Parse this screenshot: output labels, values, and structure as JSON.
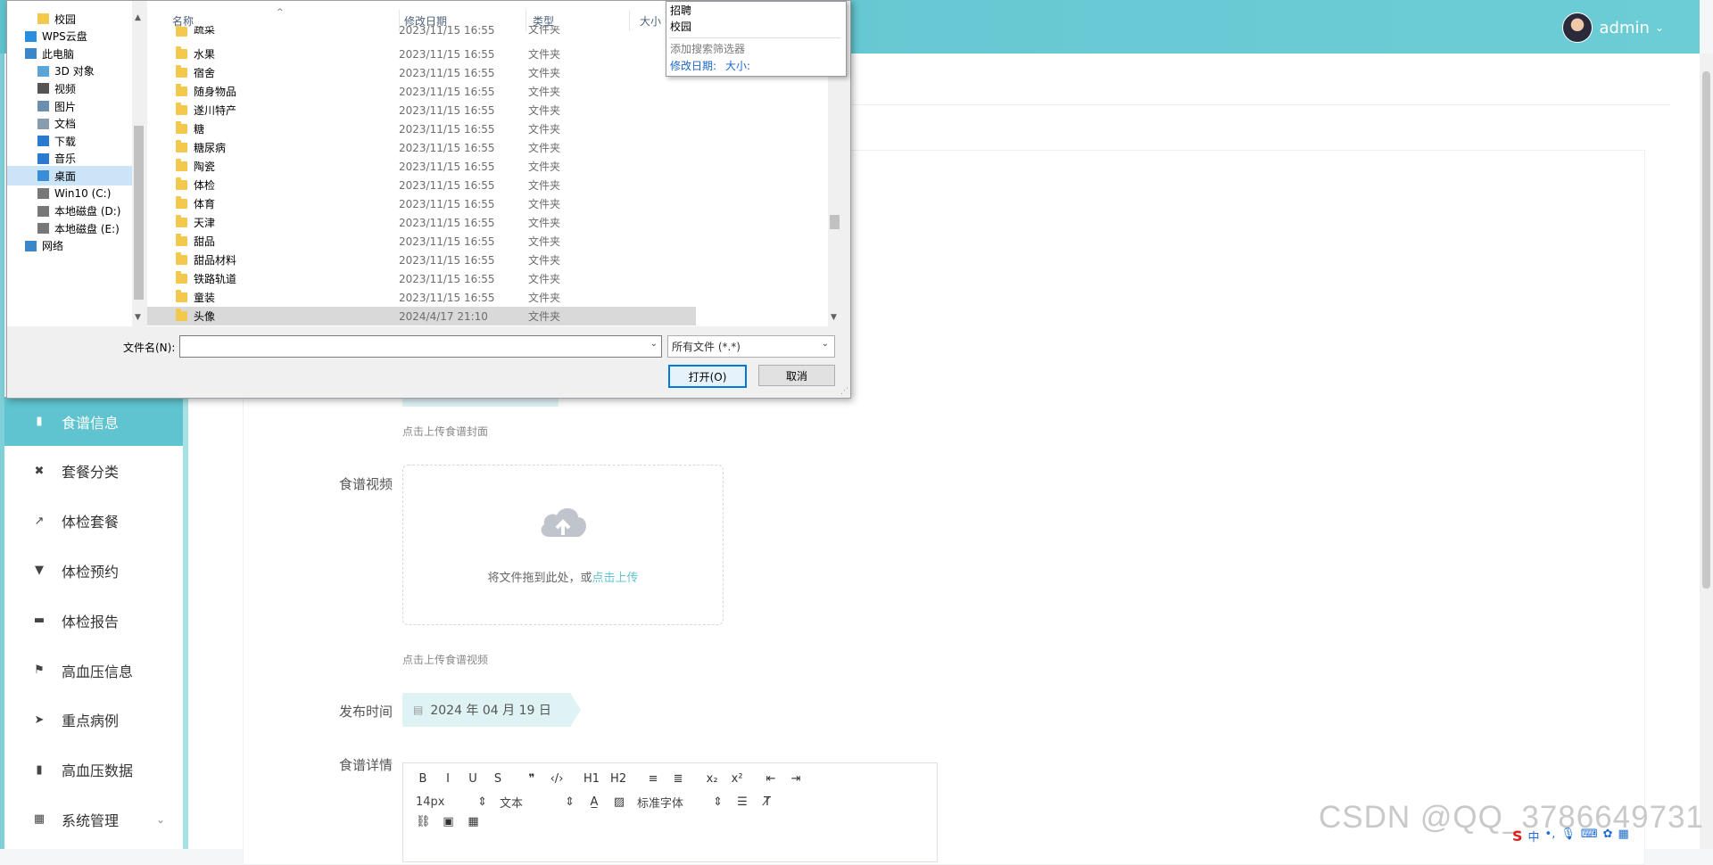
{
  "header": {
    "username": "admin"
  },
  "sidebar": {
    "items": [
      {
        "label": "食谱信息",
        "icon": "recipe-icon",
        "active": true
      },
      {
        "label": "套餐分类",
        "icon": "category-icon",
        "active": false
      },
      {
        "label": "体检套餐",
        "icon": "chart-icon",
        "active": false
      },
      {
        "label": "体检预约",
        "icon": "stamp-icon",
        "active": false
      },
      {
        "label": "体检报告",
        "icon": "briefcase-icon",
        "active": false
      },
      {
        "label": "高血压信息",
        "icon": "flag-icon",
        "active": false
      },
      {
        "label": "重点病例",
        "icon": "send-icon",
        "active": false
      },
      {
        "label": "高血压数据",
        "icon": "bar-chart-icon",
        "active": false
      },
      {
        "label": "系统管理",
        "icon": "grid-icon",
        "active": false
      }
    ]
  },
  "form": {
    "cover_hint": "点击上传食谱封面",
    "video_label": "食谱视频",
    "video_upload_text": "将文件拖到此处，或",
    "video_upload_link": "点击上传",
    "video_hint": "点击上传食谱视频",
    "date_label": "发布时间",
    "date_value": "2024 年 04 月 19 日",
    "detail_label": "食谱详情",
    "editor": {
      "row1": [
        "B",
        "I",
        "U",
        "S",
        "❞",
        "‹/›",
        "H1",
        "H2",
        "≡",
        "≣",
        "x₂",
        "x²",
        "⇤",
        "⇥"
      ],
      "font_size": "14px",
      "block_format": "文本",
      "font_family": "标准字体"
    }
  },
  "watermark": "CSDN @QQ_3786649731",
  "tray": {
    "ime": "中"
  },
  "dialog": {
    "nav": [
      {
        "label": "校园",
        "indent": 2,
        "icon": "folder-icon"
      },
      {
        "label": "WPS云盘",
        "indent": 1,
        "icon": "cloud-icon"
      },
      {
        "label": "此电脑",
        "indent": 1,
        "icon": "computer-icon"
      },
      {
        "label": "3D 对象",
        "indent": 2,
        "icon": "3d-objects-icon"
      },
      {
        "label": "视频",
        "indent": 2,
        "icon": "video-icon"
      },
      {
        "label": "图片",
        "indent": 2,
        "icon": "pictures-icon"
      },
      {
        "label": "文档",
        "indent": 2,
        "icon": "documents-icon"
      },
      {
        "label": "下载",
        "indent": 2,
        "icon": "download-icon"
      },
      {
        "label": "音乐",
        "indent": 2,
        "icon": "music-icon"
      },
      {
        "label": "桌面",
        "indent": 2,
        "icon": "desktop-icon",
        "selected": true
      },
      {
        "label": "Win10 (C:)",
        "indent": 2,
        "icon": "drive-icon"
      },
      {
        "label": "本地磁盘 (D:)",
        "indent": 2,
        "icon": "drive-icon"
      },
      {
        "label": "本地磁盘 (E:)",
        "indent": 2,
        "icon": "drive-icon"
      },
      {
        "label": "网络",
        "indent": 1,
        "icon": "network-icon"
      }
    ],
    "columns": {
      "name": "名称",
      "date": "修改日期",
      "type": "类型",
      "size": "大小"
    },
    "files": [
      {
        "name": "蔬菜",
        "date": "2023/11/15 16:55",
        "type": "文件夹"
      },
      {
        "name": "水果",
        "date": "2023/11/15 16:55",
        "type": "文件夹"
      },
      {
        "name": "宿舍",
        "date": "2023/11/15 16:55",
        "type": "文件夹"
      },
      {
        "name": "随身物品",
        "date": "2023/11/15 16:55",
        "type": "文件夹"
      },
      {
        "name": "遂川特产",
        "date": "2023/11/15 16:55",
        "type": "文件夹"
      },
      {
        "name": "糖",
        "date": "2023/11/15 16:55",
        "type": "文件夹"
      },
      {
        "name": "糖尿病",
        "date": "2023/11/15 16:55",
        "type": "文件夹"
      },
      {
        "name": "陶瓷",
        "date": "2023/11/15 16:55",
        "type": "文件夹"
      },
      {
        "name": "体检",
        "date": "2023/11/15 16:55",
        "type": "文件夹"
      },
      {
        "name": "体育",
        "date": "2023/11/15 16:55",
        "type": "文件夹"
      },
      {
        "name": "天津",
        "date": "2023/11/15 16:55",
        "type": "文件夹"
      },
      {
        "name": "甜品",
        "date": "2023/11/15 16:55",
        "type": "文件夹"
      },
      {
        "name": "甜品材料",
        "date": "2023/11/15 16:55",
        "type": "文件夹"
      },
      {
        "name": "铁路轨道",
        "date": "2023/11/15 16:55",
        "type": "文件夹"
      },
      {
        "name": "童装",
        "date": "2023/11/15 16:55",
        "type": "文件夹"
      },
      {
        "name": "头像",
        "date": "2024/4/17 21:10",
        "type": "文件夹",
        "selected": true
      }
    ],
    "filename_label": "文件名(N):",
    "filename_value": "",
    "filetype_value": "所有文件 (*.*)",
    "open_button": "打开(O)",
    "cancel_button": "取消",
    "search_popup": {
      "items": [
        "招聘",
        "校园"
      ],
      "add_filter": "添加搜索筛选器",
      "filter_date": "修改日期:",
      "filter_size": "大小:"
    }
  }
}
